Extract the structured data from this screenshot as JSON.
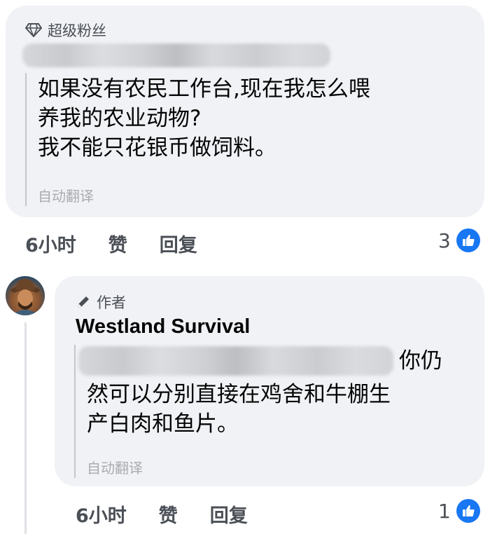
{
  "comment1": {
    "badge": "超级粉丝",
    "lines": [
      "如果没有农民工作台,现在我怎么喂",
      "养我的农业动物?",
      "我不能只花银币做饲料。"
    ],
    "auto_translate": "自动翻译",
    "time": "6小时",
    "like_label": "赞",
    "reply_label": "回复",
    "reaction_count": "3"
  },
  "comment2": {
    "badge": "作者",
    "author": "Westland Survival",
    "lines": [
      "你仍",
      "然可以分别直接在鸡舍和牛棚生",
      "产白肉和鱼片。"
    ],
    "auto_translate": "自动翻译",
    "time": "6小时",
    "like_label": "赞",
    "reply_label": "回复",
    "reaction_count": "1"
  },
  "colors": {
    "like_blue": "#1877f2",
    "bubble": "#f0f2f5"
  },
  "icons": {
    "badge1": "diamond-icon",
    "badge2": "pencil-icon",
    "reaction": "thumbs-up-icon"
  }
}
